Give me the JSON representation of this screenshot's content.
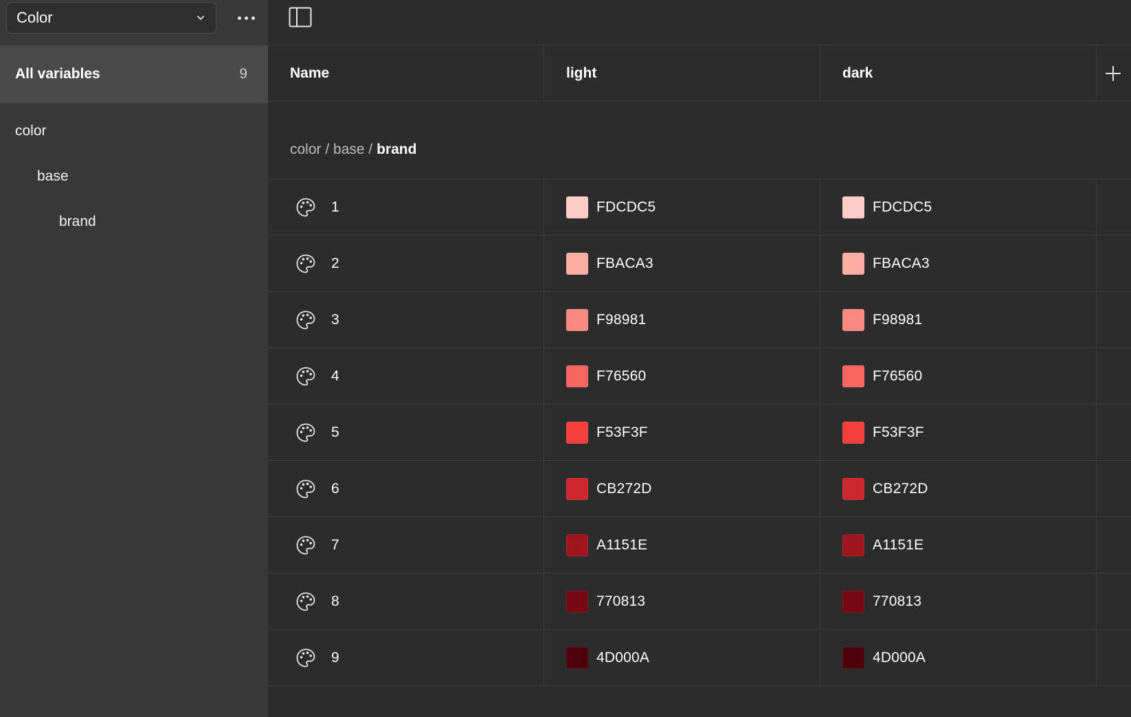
{
  "sidebar": {
    "collection": "Color",
    "all_variables": {
      "label": "All variables",
      "count": "9"
    },
    "tree": [
      {
        "label": "color"
      },
      {
        "label": "base"
      },
      {
        "label": "brand"
      }
    ]
  },
  "table": {
    "headers": {
      "name": "Name",
      "mode1": "light",
      "mode2": "dark"
    },
    "group_path": {
      "prefix": "color / base / ",
      "current": "brand"
    },
    "rows": [
      {
        "name": "1",
        "light": "FDCDC5",
        "dark": "FDCDC5",
        "color": "#FDCDC5"
      },
      {
        "name": "2",
        "light": "FBACA3",
        "dark": "FBACA3",
        "color": "#FBACA3"
      },
      {
        "name": "3",
        "light": "F98981",
        "dark": "F98981",
        "color": "#F98981"
      },
      {
        "name": "4",
        "light": "F76560",
        "dark": "F76560",
        "color": "#F76560"
      },
      {
        "name": "5",
        "light": "F53F3F",
        "dark": "F53F3F",
        "color": "#F53F3F"
      },
      {
        "name": "6",
        "light": "CB272D",
        "dark": "CB272D",
        "color": "#CB272D"
      },
      {
        "name": "7",
        "light": "A1151E",
        "dark": "A1151E",
        "color": "#A1151E"
      },
      {
        "name": "8",
        "light": "770813",
        "dark": "770813",
        "color": "#770813"
      },
      {
        "name": "9",
        "light": "4D000A",
        "dark": "4D000A",
        "color": "#4D000A"
      }
    ]
  },
  "icons": {
    "collection_chevron": "chevron-down-icon",
    "more": "more-horizontal-icon",
    "panel_toggle": "sidebar-toggle-icon",
    "add_mode": "plus-icon",
    "variable": "palette-icon"
  }
}
